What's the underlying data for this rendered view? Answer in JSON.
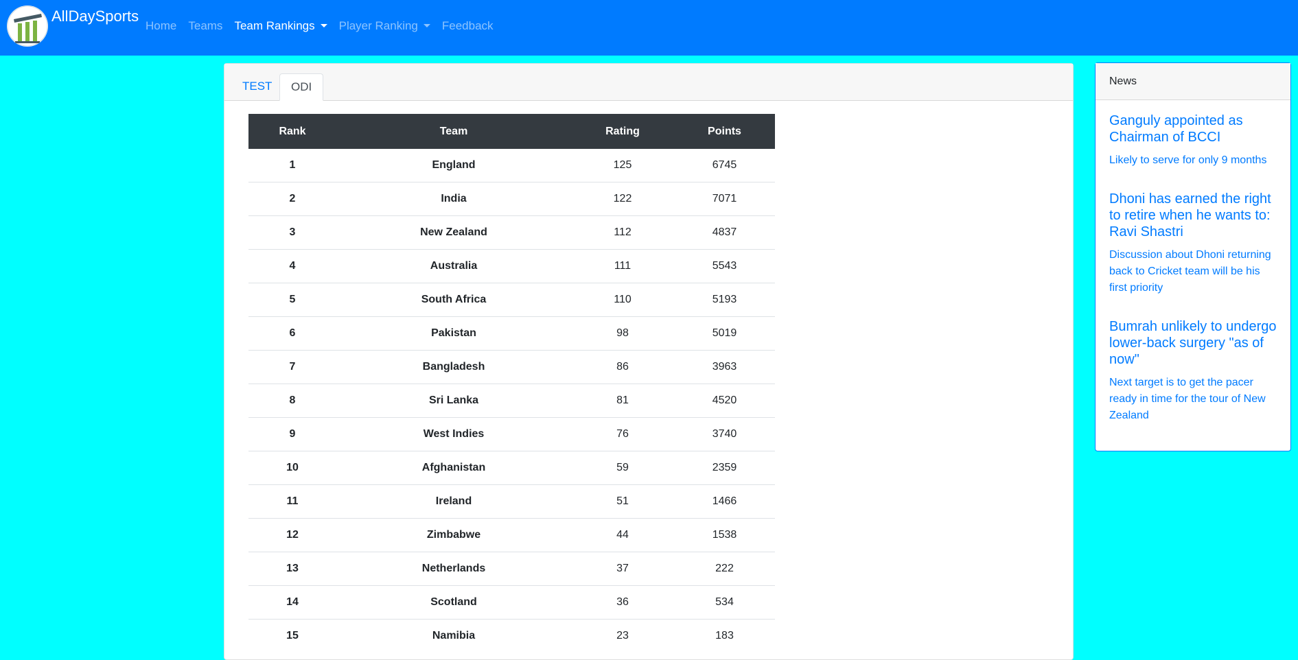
{
  "brand": "AllDaySports",
  "nav": {
    "home": "Home",
    "teams": "Teams",
    "team_rankings": "Team Rankings",
    "player_ranking": "Player Ranking",
    "feedback": "Feedback"
  },
  "tabs": {
    "test": "TEST",
    "odi": "ODI"
  },
  "table": {
    "headers": {
      "rank": "Rank",
      "team": "Team",
      "rating": "Rating",
      "points": "Points"
    },
    "rows": [
      {
        "rank": "1",
        "team": "England",
        "rating": "125",
        "points": "6745"
      },
      {
        "rank": "2",
        "team": "India",
        "rating": "122",
        "points": "7071"
      },
      {
        "rank": "3",
        "team": "New Zealand",
        "rating": "112",
        "points": "4837"
      },
      {
        "rank": "4",
        "team": "Australia",
        "rating": "111",
        "points": "5543"
      },
      {
        "rank": "5",
        "team": "South Africa",
        "rating": "110",
        "points": "5193"
      },
      {
        "rank": "6",
        "team": "Pakistan",
        "rating": "98",
        "points": "5019"
      },
      {
        "rank": "7",
        "team": "Bangladesh",
        "rating": "86",
        "points": "3963"
      },
      {
        "rank": "8",
        "team": "Sri Lanka",
        "rating": "81",
        "points": "4520"
      },
      {
        "rank": "9",
        "team": "West Indies",
        "rating": "76",
        "points": "3740"
      },
      {
        "rank": "10",
        "team": "Afghanistan",
        "rating": "59",
        "points": "2359"
      },
      {
        "rank": "11",
        "team": "Ireland",
        "rating": "51",
        "points": "1466"
      },
      {
        "rank": "12",
        "team": "Zimbabwe",
        "rating": "44",
        "points": "1538"
      },
      {
        "rank": "13",
        "team": "Netherlands",
        "rating": "37",
        "points": "222"
      },
      {
        "rank": "14",
        "team": "Scotland",
        "rating": "36",
        "points": "534"
      },
      {
        "rank": "15",
        "team": "Namibia",
        "rating": "23",
        "points": "183"
      }
    ]
  },
  "news": {
    "header": "News",
    "items": [
      {
        "title": "Ganguly appointed as Chairman of BCCI",
        "text": "Likely to serve for only 9 months"
      },
      {
        "title": "Dhoni has earned the right to retire when he wants to: Ravi Shastri",
        "text": "Discussion about Dhoni returning back to Cricket team will be his first priority"
      },
      {
        "title": "Bumrah unlikely to undergo lower-back surgery \"as of now\"",
        "text": "Next target is to get the pacer ready in time for the tour of New Zealand"
      }
    ]
  },
  "colors": {
    "navbar": "#007bff",
    "page_background": "#00ffff",
    "table_header": "#343a40",
    "link": "#007bff"
  }
}
